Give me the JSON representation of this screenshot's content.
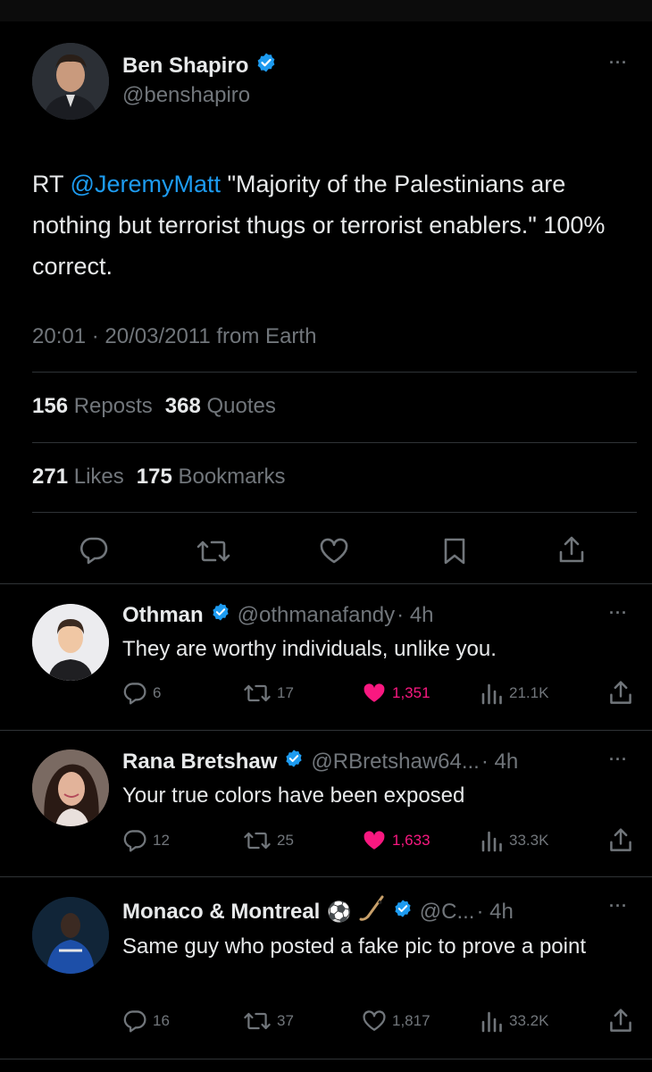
{
  "main_tweet": {
    "author_name": "Ben Shapiro",
    "handle": "@benshapiro",
    "text_prefix": "RT ",
    "mention": "@JeremyMatt",
    "text_rest": " \"Majority of the Palestinians are nothing but terrorist thugs or terrorist enablers.\" 100% correct.",
    "timestamp": "20:01 · 20/03/2011 from Earth",
    "reposts_count": "156",
    "reposts_label": "Reposts",
    "quotes_count": "368",
    "quotes_label": "Quotes",
    "likes_count": "271",
    "likes_label": "Likes",
    "bookmarks_count": "175",
    "bookmarks_label": "Bookmarks"
  },
  "replies": [
    {
      "name": "Othman",
      "handle": "@othmanafandy",
      "time": "· 4h",
      "text": "They are worthy individuals, unlike you.",
      "replies": "6",
      "reposts": "17",
      "likes": "1,351",
      "liked": true,
      "views": "21.1K"
    },
    {
      "name": "Rana Bretshaw",
      "handle": "@RBretshaw64...",
      "time": "· 4h",
      "text": "Your true colors have been exposed",
      "replies": "12",
      "reposts": "25",
      "likes": "1,633",
      "liked": true,
      "views": "33.3K"
    },
    {
      "name": "Monaco & Montreal",
      "emoji": "⚽",
      "handle": "@C...",
      "time": "· 4h",
      "text": "Same guy who posted a fake pic to prove a point",
      "replies": "16",
      "reposts": "37",
      "likes": "1,817",
      "liked": false,
      "views": "33.2K"
    }
  ],
  "colors": {
    "accent": "#1d9bf0",
    "like_active": "#f91880",
    "muted": "#71767b",
    "text": "#e7e9ea",
    "background": "#000000"
  },
  "icons": [
    "more-icon",
    "verified-icon",
    "reply-icon",
    "repost-icon",
    "like-icon",
    "bookmark-icon",
    "share-icon",
    "views-icon"
  ]
}
